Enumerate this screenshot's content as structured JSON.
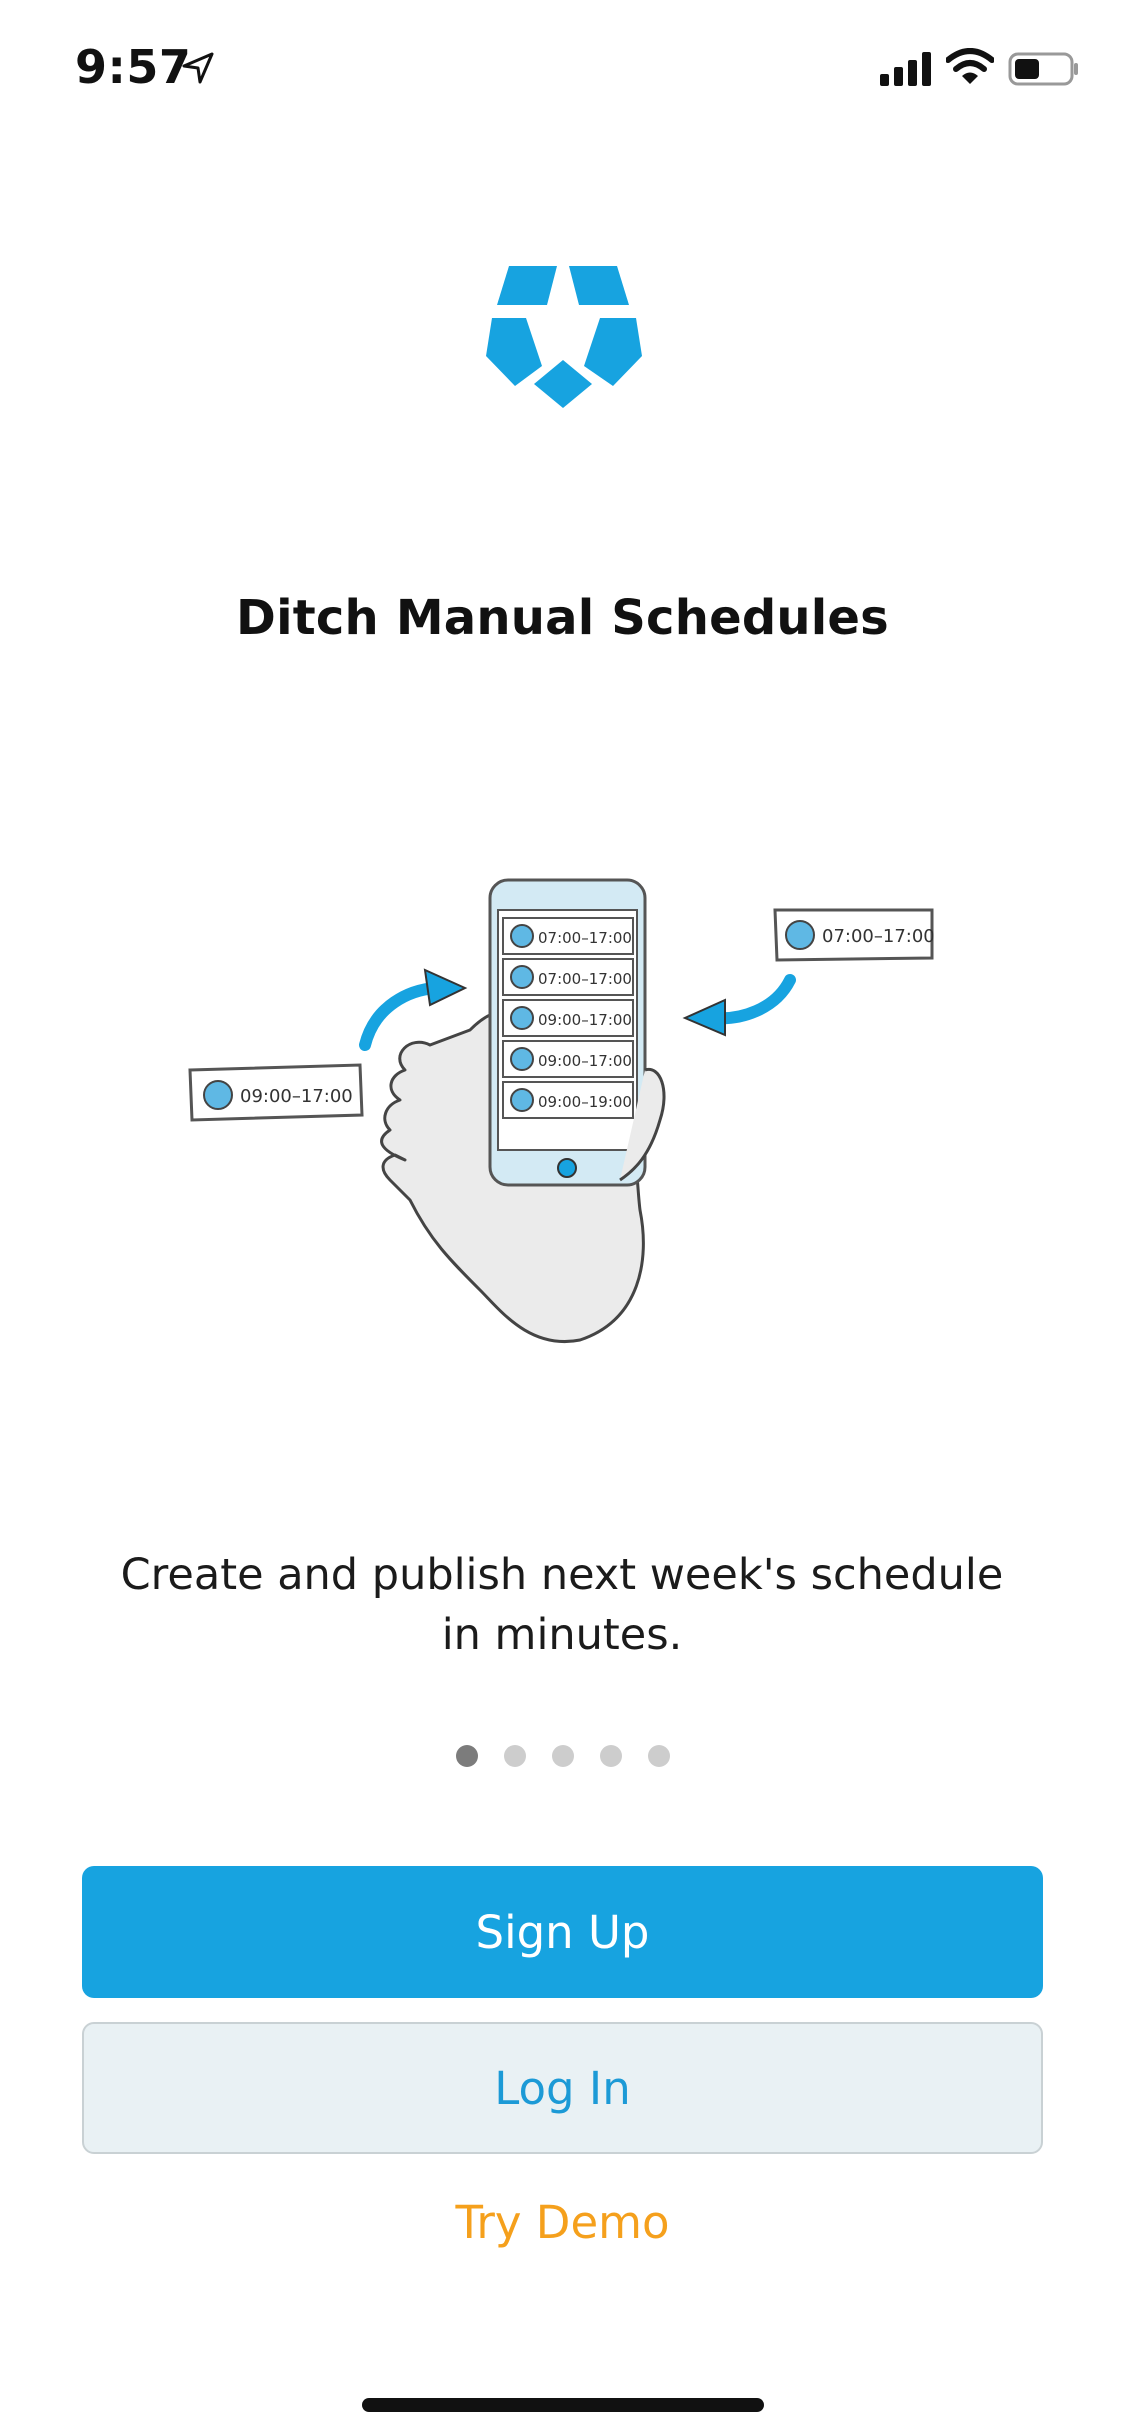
{
  "status_bar": {
    "time": "9:57",
    "icons": [
      "location-arrow-icon",
      "cellular-signal-icon",
      "wifi-icon",
      "battery-icon"
    ]
  },
  "logo": {
    "icon": "pentagon-logo-icon",
    "color": "#17a3e0"
  },
  "headline": "Ditch Manual Schedules",
  "illustration": {
    "shift_cards": [
      "07:00–17:00",
      "07:00–17:00",
      "09:00–17:00",
      "09:00–17:00",
      "09:00–19:00"
    ],
    "left_card": "09:00–17:00",
    "right_card": "07:00–17:00"
  },
  "subtitle": "Create and publish next week's schedule in minutes.",
  "pagination": {
    "count": 5,
    "active_index": 0
  },
  "buttons": {
    "signup": "Sign Up",
    "login": "Log In",
    "try_demo": "Try Demo"
  },
  "colors": {
    "accent": "#17a3e0",
    "demo": "#f5a01c",
    "login_bg": "#e9f1f4"
  }
}
